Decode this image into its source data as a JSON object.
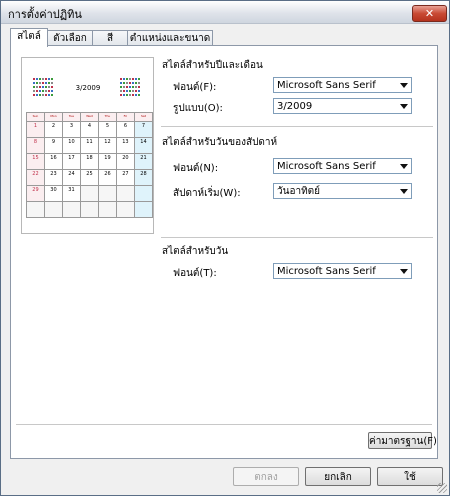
{
  "window": {
    "title": "การตั้งค่าปฏิทิน"
  },
  "tabs": [
    {
      "label": "สไตล์",
      "active": true
    },
    {
      "label": "ตัวเลือก",
      "active": false
    },
    {
      "label": "สี",
      "active": false
    },
    {
      "label": "ตำแหน่งและขนาด",
      "active": false
    }
  ],
  "preview": {
    "month_label": "3/2009",
    "weekday_headers": [
      "Sun",
      "Mon",
      "Tue",
      "Wed",
      "Thu",
      "Fri",
      "Sat"
    ],
    "weeks": [
      [
        "1",
        "2",
        "3",
        "4",
        "5",
        "6",
        "7"
      ],
      [
        "8",
        "9",
        "10",
        "11",
        "12",
        "13",
        "14"
      ],
      [
        "15",
        "16",
        "17",
        "18",
        "19",
        "20",
        "21"
      ],
      [
        "22",
        "23",
        "24",
        "25",
        "26",
        "27",
        "28"
      ],
      [
        "29",
        "30",
        "31",
        "",
        "",
        "",
        ""
      ],
      [
        "",
        "",
        "",
        "",
        "",
        "",
        ""
      ]
    ]
  },
  "month_style": {
    "title": "สไตล์สำหรับปีและเดือน",
    "font_label": "ฟอนต์(F):",
    "font_value": "Microsoft Sans Serif",
    "format_label": "รูปแบบ(O):",
    "format_value": "3/2009"
  },
  "week_style": {
    "title": "สไตล์สำหรับวันของสัปดาห์",
    "font_label": "ฟอนต์(N):",
    "font_value": "Microsoft Sans Serif",
    "start_label": "สัปดาห์เริ่ม(W):",
    "start_value": "วันอาทิตย์"
  },
  "day_style": {
    "title": "สไตล์สำหรับวัน",
    "font_label": "ฟอนต์(T):",
    "font_value": "Microsoft Sans Serif"
  },
  "buttons": {
    "default_label": "ค่ามาตรฐาน(F)",
    "ok_label": "ตกลง",
    "cancel_label": "ยกเลิก",
    "apply_label": "ใช้"
  },
  "colors": {
    "sunday": "#c0304a",
    "saturday_bg": "#dff3fb",
    "close_button": "#c94a34"
  }
}
